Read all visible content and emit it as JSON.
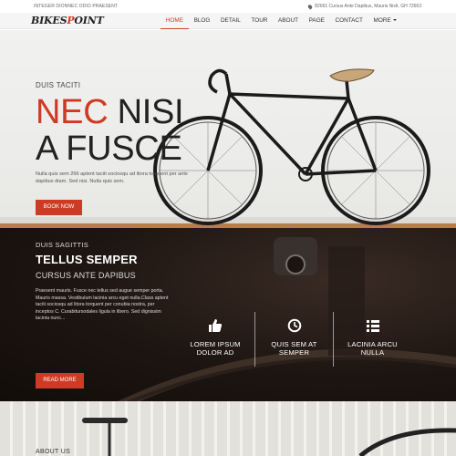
{
  "topbar": {
    "tagline": "INTEGER DIONNEC ODIO PRAESENT",
    "address": "82661 Cursus Ante Dapibus, Mauris Nislt, GH 72663"
  },
  "logo": {
    "part1": "BIKES",
    "part2": "P",
    "part3": "OINT"
  },
  "nav": {
    "items": [
      "HOME",
      "BLOG",
      "DETAIL",
      "TOUR",
      "ABOUT",
      "PAGE",
      "CONTACT",
      "MORE"
    ],
    "active_index": 0
  },
  "hero": {
    "kicker": "DUIS TACITI",
    "headline_red": "NEC",
    "headline_rest": " NISI",
    "headline_line2": "A FUSCE",
    "description": "Nulla quis sem 266 aptent taciti sociosqu ad litora torquent per ante dapibus diam. Sed nisi. Nulla quis sem.",
    "button": "BOOK NOW"
  },
  "services": {
    "kicker": "DUIS SAGITTIS",
    "title": "TELLUS SEMPER",
    "subtitle": "CURSUS ANTE DAPIBUS",
    "description": "Praesent mauris. Fusce nec tellus sed augue semper porta. Mauris massa. Vestibulum lacinia arcu eget nulla.Class aptent taciti sociosqu ad litora torquent per conubia nostra, per inceptos C. Curabitursodales ligula in libero. Sed dignissim lacinia nunc...",
    "button": "READ MORE",
    "features": [
      {
        "icon": "thumbs-up-icon",
        "label_l1": "LOREM IPSUM",
        "label_l2": "DOLOR AD"
      },
      {
        "icon": "clock-icon",
        "label_l1": "QUIS SEM AT",
        "label_l2": "SEMPER"
      },
      {
        "icon": "list-icon",
        "label_l1": "LACINIA ARCU",
        "label_l2": "NULLA"
      }
    ]
  },
  "about": {
    "heading": "ABOUT US"
  },
  "colors": {
    "accent": "#cf3a24",
    "dark_bg": "#1d1511"
  }
}
